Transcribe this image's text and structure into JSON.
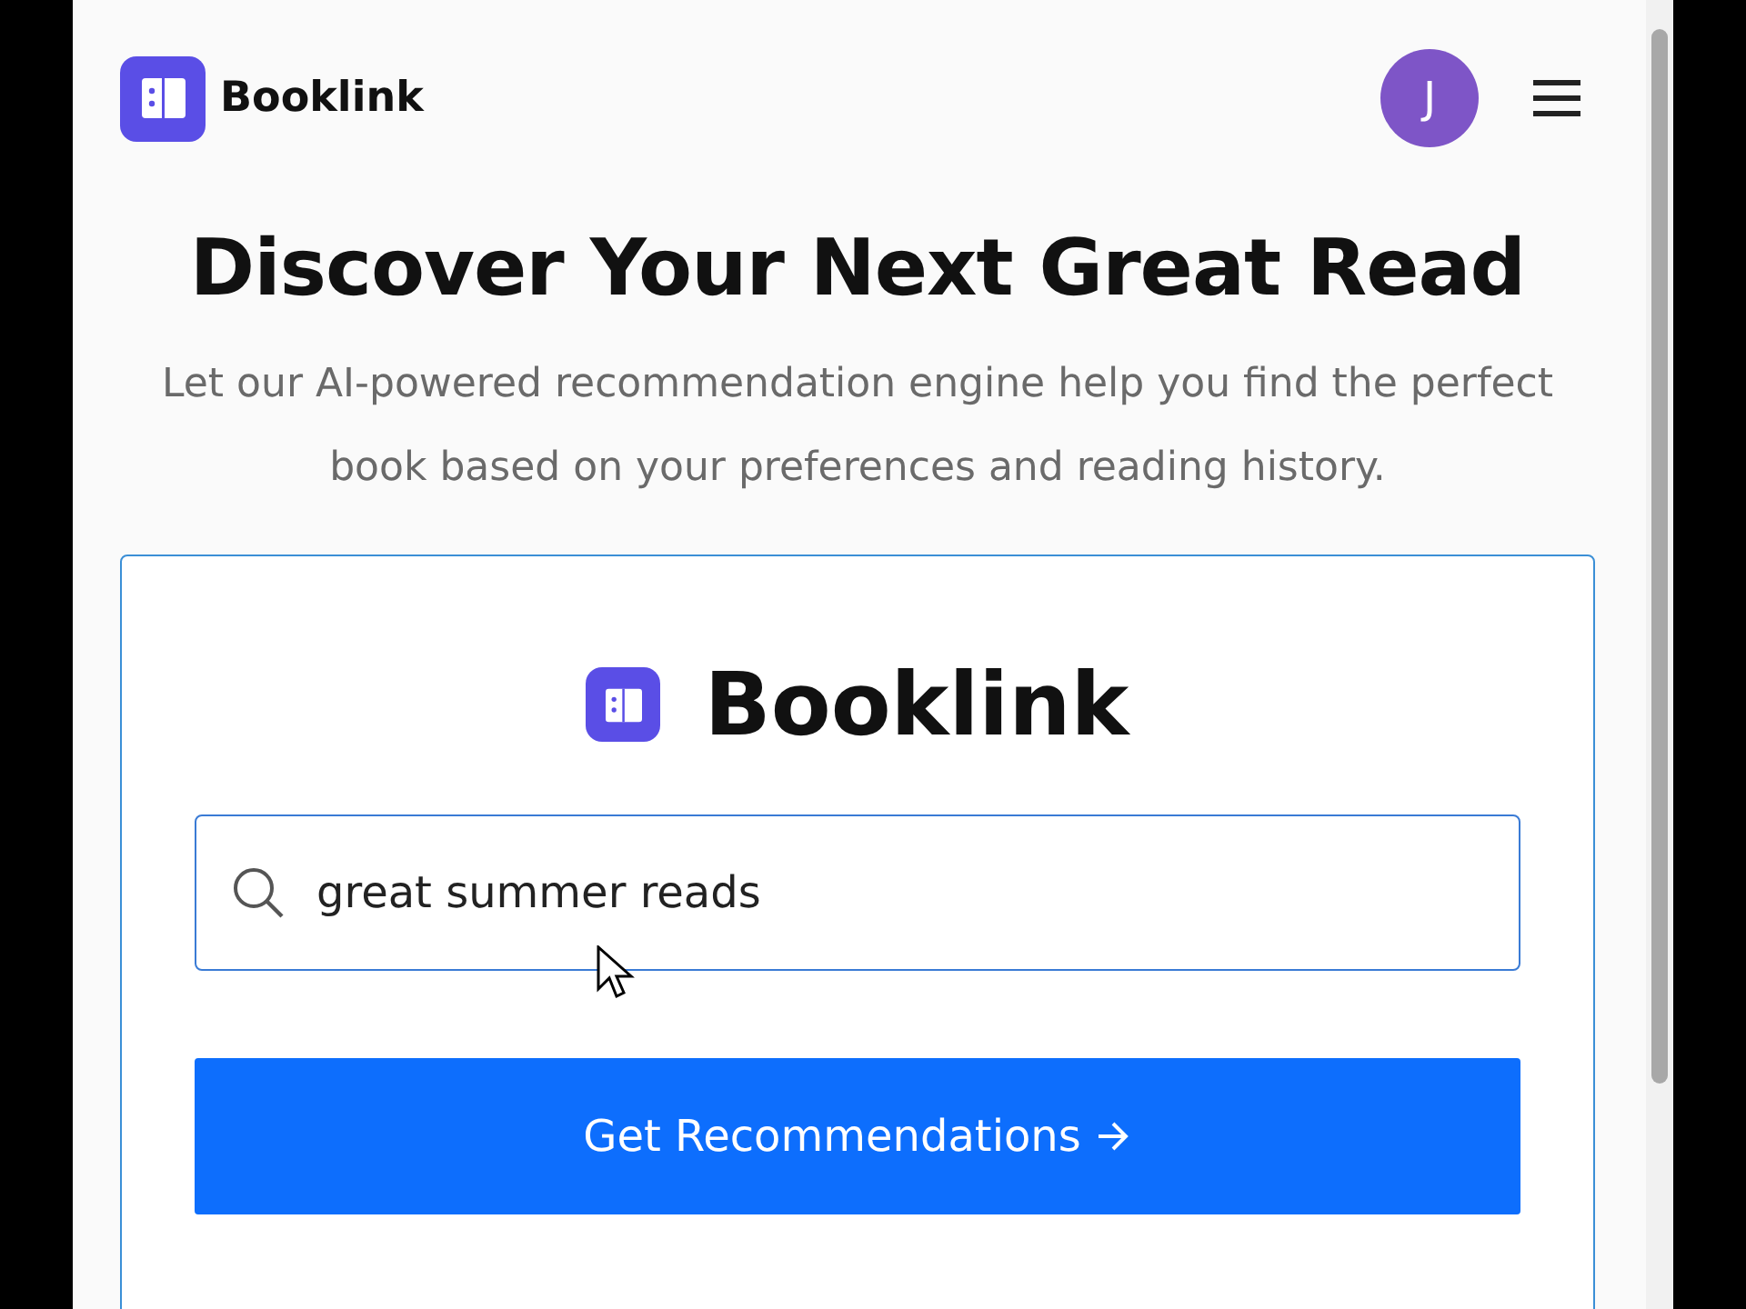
{
  "header": {
    "brand": "Booklink",
    "avatar_initial": "J"
  },
  "hero": {
    "title": "Discover Your Next Great Read",
    "subtitle": "Let our AI-powered recommendation engine help you find the perfect book based on your preferences and reading history."
  },
  "search_card": {
    "brand": "Booklink",
    "search": {
      "value": "great summer reads"
    },
    "button": "Get Recommendations"
  }
}
